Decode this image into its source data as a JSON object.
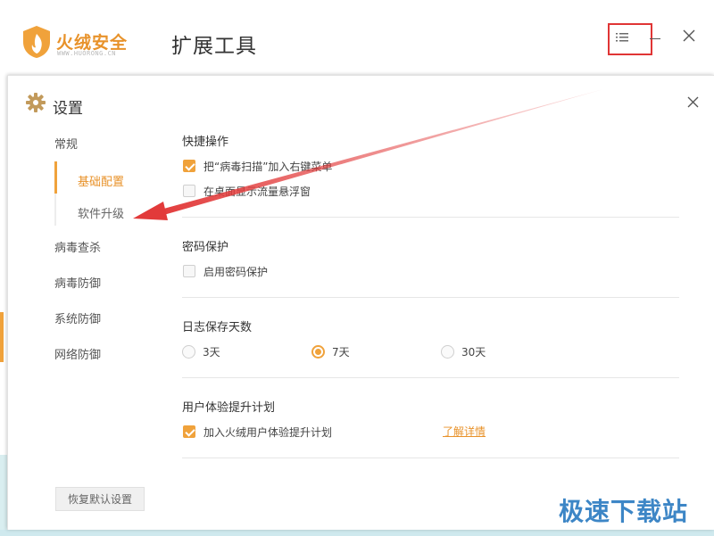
{
  "app": {
    "brand": "火绒安全",
    "brand_url": "WWW.HUORONG.CN",
    "title": "扩展工具"
  },
  "dialog": {
    "title": "设置",
    "nav": {
      "general": "常规",
      "sub_basic": "基础配置",
      "sub_upgrade": "软件升级",
      "virus_scan": "病毒查杀",
      "virus_defense": "病毒防御",
      "system_defense": "系统防御",
      "network_defense": "网络防御"
    },
    "sections": {
      "quick": {
        "title": "快捷操作",
        "opt1": "把“病毒扫描”加入右键菜单",
        "opt1_checked": true,
        "opt2": "在桌面显示流量悬浮窗",
        "opt2_checked": false
      },
      "password": {
        "title": "密码保护",
        "opt1": "启用密码保护",
        "opt1_checked": false
      },
      "log": {
        "title": "日志保存天数",
        "options": [
          "3天",
          "7天",
          "30天"
        ],
        "selected": "7天"
      },
      "ux": {
        "title": "用户体验提升计划",
        "opt1": "加入火绒用户体验提升计划",
        "opt1_checked": true,
        "link": "了解详情"
      }
    },
    "reset_button": "恢复默认设置"
  },
  "watermark": "极速下载站",
  "colors": {
    "accent": "#f0a23b",
    "highlight": "#e03535",
    "watermark": "#3d86c6"
  }
}
